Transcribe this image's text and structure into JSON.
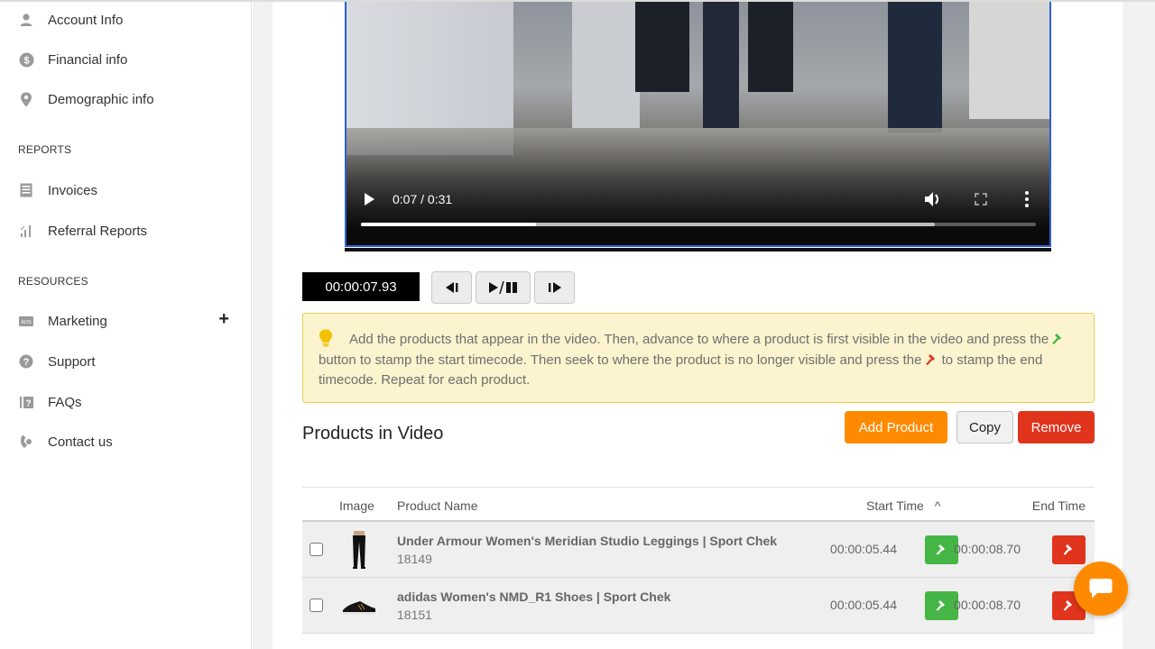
{
  "sidebar": {
    "items_top": [
      {
        "label": "Account Info",
        "icon": "user-icon"
      },
      {
        "label": "Financial info",
        "icon": "dollar-icon"
      },
      {
        "label": "Demographic info",
        "icon": "map-pin-icon"
      }
    ],
    "reports_heading": "REPORTS",
    "reports": [
      {
        "label": "Invoices",
        "icon": "invoice-icon"
      },
      {
        "label": "Referral Reports",
        "icon": "bar-chart-icon"
      }
    ],
    "resources_heading": "RESOURCES",
    "resources": [
      {
        "label": "Marketing",
        "icon": "ads-icon",
        "expand": "+"
      },
      {
        "label": "Support",
        "icon": "question-circle-icon"
      },
      {
        "label": "FAQs",
        "icon": "faq-icon"
      },
      {
        "label": "Contact us",
        "icon": "phone-icon"
      }
    ]
  },
  "video": {
    "time_display": "0:07 / 0:31",
    "progress_fraction": 0.26,
    "buffered_fraction": 0.85
  },
  "timeline": {
    "timecode": "00:00:07.93",
    "prev_frame_label": "◀I",
    "play_pause_label": "▶/▮▮",
    "next_frame_label": "I▶"
  },
  "tip": {
    "part1": "Add the products that appear in the video. Then, advance to where a product is first visible in the video and press the",
    "part2": "button to stamp the start timecode. Then seek to where the product is no longer visible and press the",
    "part3": "to stamp the end timecode. Repeat for each product.",
    "colors": {
      "start": "#45b545",
      "end": "#e0341c",
      "bulb": "#f2c200"
    }
  },
  "products": {
    "title": "Products in Video",
    "add_label": "Add Product",
    "copy_label": "Copy",
    "remove_label": "Remove",
    "columns": {
      "image": "Image",
      "name": "Product Name",
      "start": "Start Time",
      "sort_indicator": "^",
      "end": "End Time"
    },
    "rows": [
      {
        "name": "Under Armour Women's Meridian Studio Leggings | Sport Chek",
        "id": "18149",
        "start": "00:00:05.44",
        "end": "00:00:08.70",
        "image": "leggings"
      },
      {
        "name": "adidas Women's NMD_R1 Shoes | Sport Chek",
        "id": "18151",
        "start": "00:00:05.44",
        "end": "00:00:08.70",
        "image": "shoe"
      }
    ]
  },
  "colors": {
    "accent_orange": "#ff8a00",
    "danger_red": "#e0341c",
    "success_green": "#45b545",
    "tip_bg": "#fcf4cf"
  }
}
